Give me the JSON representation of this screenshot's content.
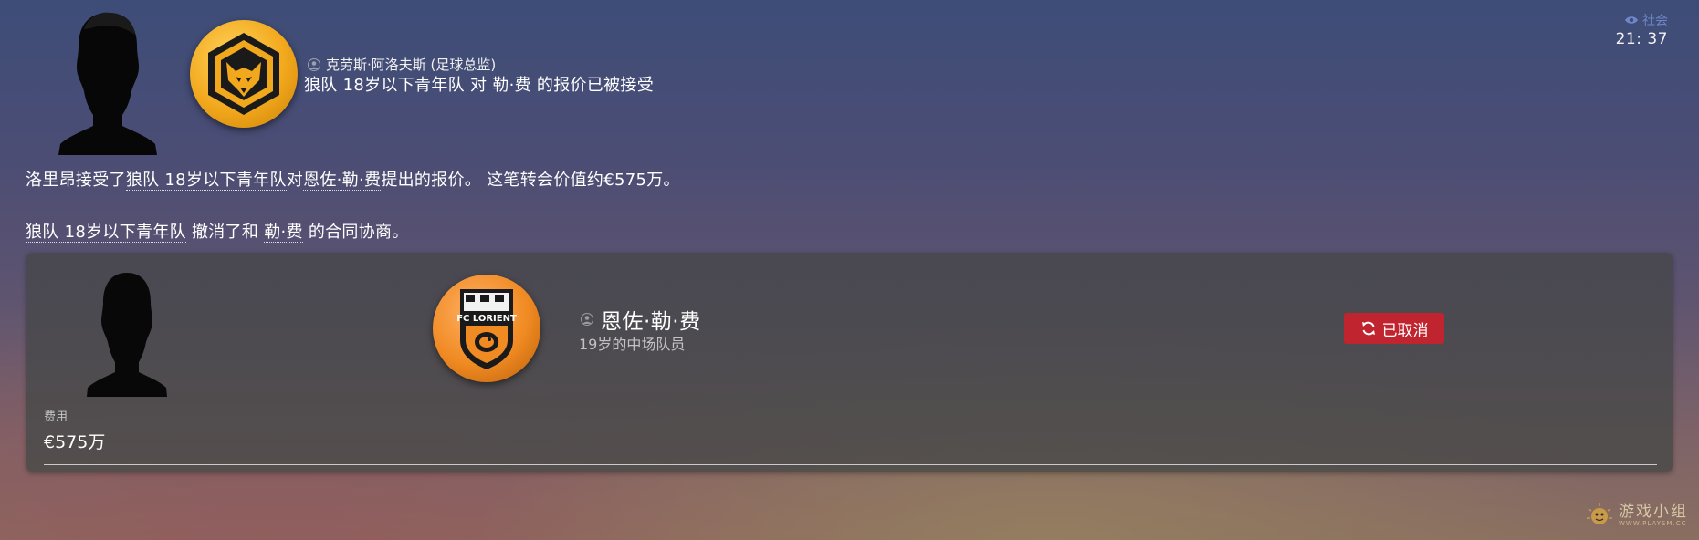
{
  "header": {
    "sender_name": "克劳斯·阿洛夫斯 (足球总监)",
    "headline": "狼队 18岁以下青年队 对 勒·费 的报价已被接受",
    "top_right_link": "社会",
    "time": "21: 37"
  },
  "body": {
    "paragraph1_prefix": "洛里昂接受了",
    "paragraph1_link": "狼队 18岁以下青年队",
    "paragraph1_mid": "对",
    "paragraph1_player": "恩佐·勒·费",
    "paragraph1_suffix": "提出的报价。 这笔转会价值约€575万。",
    "paragraph2_link": "狼队 18岁以下青年队",
    "paragraph2_mid": " 撤消了和 ",
    "paragraph2_player": "勒·费",
    "paragraph2_suffix": " 的合同协商。"
  },
  "card": {
    "player_name": "恩佐·勒·费",
    "player_desc": "19岁的中场队员",
    "status_label": "已取消",
    "fee_label": "费用",
    "fee_value": "€575万"
  },
  "clubs": {
    "buyer_badge_text": "",
    "seller_badge_text": "FC LORIENT"
  },
  "watermark": {
    "text": "游戏小组",
    "sub": "WWW.PLAYSM.CC"
  },
  "colors": {
    "status_red": "#c0242e",
    "wolves_gold": "#f2a81c",
    "lorient_orange": "#f08a22",
    "link_blue": "#6f86c7"
  },
  "icons": {
    "sender": "person-icon",
    "player": "person-icon",
    "status": "refresh-icon",
    "top_right": "eye-icon"
  }
}
